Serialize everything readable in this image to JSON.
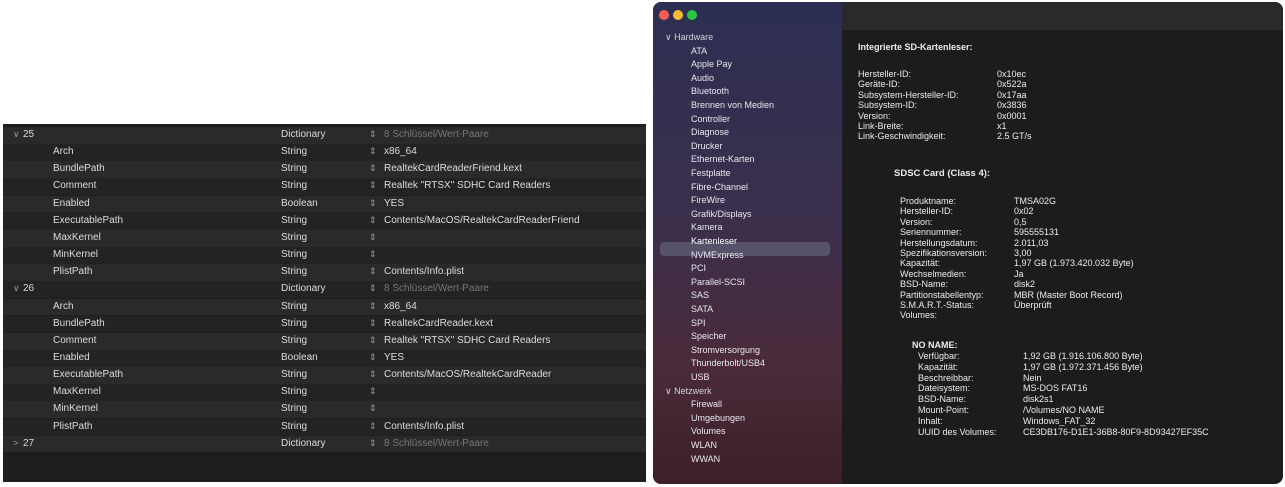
{
  "plist_editor": {
    "rows": [
      {
        "level": "group",
        "disclosure": "∨",
        "key": "25",
        "type": "Dictionary",
        "value": "8 Schlüssel/Wert-Paare",
        "dim": true
      },
      {
        "level": "child",
        "key": "Arch",
        "type": "String",
        "value": "x86_64"
      },
      {
        "level": "child",
        "key": "BundlePath",
        "type": "String",
        "value": "RealtekCardReaderFriend.kext"
      },
      {
        "level": "child",
        "key": "Comment",
        "type": "String",
        "value": "Realtek \"RTSX\" SDHC Card Readers"
      },
      {
        "level": "child",
        "key": "Enabled",
        "type": "Boolean",
        "value": "YES"
      },
      {
        "level": "child",
        "key": "ExecutablePath",
        "type": "String",
        "value": "Contents/MacOS/RealtekCardReaderFriend"
      },
      {
        "level": "child",
        "key": "MaxKernel",
        "type": "String",
        "value": ""
      },
      {
        "level": "child",
        "key": "MinKernel",
        "type": "String",
        "value": ""
      },
      {
        "level": "child",
        "key": "PlistPath",
        "type": "String",
        "value": "Contents/Info.plist"
      },
      {
        "level": "group",
        "disclosure": "∨",
        "key": "26",
        "type": "Dictionary",
        "value": "8 Schlüssel/Wert-Paare",
        "dim": true
      },
      {
        "level": "child",
        "key": "Arch",
        "type": "String",
        "value": "x86_64"
      },
      {
        "level": "child",
        "key": "BundlePath",
        "type": "String",
        "value": "RealtekCardReader.kext"
      },
      {
        "level": "child",
        "key": "Comment",
        "type": "String",
        "value": "Realtek \"RTSX\" SDHC Card Readers"
      },
      {
        "level": "child",
        "key": "Enabled",
        "type": "Boolean",
        "value": "YES"
      },
      {
        "level": "child",
        "key": "ExecutablePath",
        "type": "String",
        "value": "Contents/MacOS/RealtekCardReader"
      },
      {
        "level": "child",
        "key": "MaxKernel",
        "type": "String",
        "value": ""
      },
      {
        "level": "child",
        "key": "MinKernel",
        "type": "String",
        "value": ""
      },
      {
        "level": "child",
        "key": "PlistPath",
        "type": "String",
        "value": "Contents/Info.plist"
      },
      {
        "level": "group",
        "disclosure": ">",
        "key": "27",
        "type": "Dictionary",
        "value": "8 Schlüssel/Wert-Paare",
        "dim": true
      }
    ],
    "stepper_glyph": "⇕"
  },
  "system_info": {
    "traffic_lights": {
      "close": "#ff5f57",
      "minimize": "#febc2e",
      "zoom": "#28c840"
    },
    "sidebar": [
      {
        "kind": "group",
        "label": "Hardware",
        "disclosure": "∨"
      },
      {
        "kind": "child",
        "label": "ATA"
      },
      {
        "kind": "child",
        "label": "Apple Pay"
      },
      {
        "kind": "child",
        "label": "Audio"
      },
      {
        "kind": "child",
        "label": "Bluetooth"
      },
      {
        "kind": "child",
        "label": "Brennen von Medien"
      },
      {
        "kind": "child",
        "label": "Controller"
      },
      {
        "kind": "child",
        "label": "Diagnose"
      },
      {
        "kind": "child",
        "label": "Drucker"
      },
      {
        "kind": "child",
        "label": "Ethernet-Karten"
      },
      {
        "kind": "child",
        "label": "Festplatte"
      },
      {
        "kind": "child",
        "label": "Fibre-Channel"
      },
      {
        "kind": "child",
        "label": "FireWire"
      },
      {
        "kind": "child",
        "label": "Grafik/Displays"
      },
      {
        "kind": "child",
        "label": "Kamera"
      },
      {
        "kind": "child",
        "label": "Kartenleser",
        "selected": true
      },
      {
        "kind": "child",
        "label": "NVMExpress"
      },
      {
        "kind": "child",
        "label": "PCI"
      },
      {
        "kind": "child",
        "label": "Parallel-SCSI"
      },
      {
        "kind": "child",
        "label": "SAS"
      },
      {
        "kind": "child",
        "label": "SATA"
      },
      {
        "kind": "child",
        "label": "SPI"
      },
      {
        "kind": "child",
        "label": "Speicher"
      },
      {
        "kind": "child",
        "label": "Stromversorgung"
      },
      {
        "kind": "child",
        "label": "Thunderbolt/USB4"
      },
      {
        "kind": "child",
        "label": "USB"
      },
      {
        "kind": "group",
        "label": "Netzwerk",
        "disclosure": "∨"
      },
      {
        "kind": "child",
        "label": "Firewall"
      },
      {
        "kind": "child",
        "label": "Umgebungen"
      },
      {
        "kind": "child",
        "label": "Volumes"
      },
      {
        "kind": "child",
        "label": "WLAN"
      },
      {
        "kind": "child",
        "label": "WWAN"
      }
    ],
    "detail": {
      "heading": "Integrierte SD-Kartenleser:",
      "reader_props": [
        {
          "label": "Hersteller-ID:",
          "value": "0x10ec"
        },
        {
          "label": "Geräte-ID:",
          "value": "0x522a"
        },
        {
          "label": "Subsystem-Hersteller-ID:",
          "value": "0x17aa"
        },
        {
          "label": "Subsystem-ID:",
          "value": "0x3836"
        },
        {
          "label": "Version:",
          "value": "0x0001"
        },
        {
          "label": "Link-Breite:",
          "value": "x1"
        },
        {
          "label": "Link-Geschwindigkeit:",
          "value": "2.5 GT/s"
        }
      ],
      "card_heading": "SDSC Card (Class 4):",
      "card_props": [
        {
          "label": "Produktname:",
          "value": "TMSA02G"
        },
        {
          "label": "Hersteller-ID:",
          "value": "0x02"
        },
        {
          "label": "Version:",
          "value": "0,5"
        },
        {
          "label": "Seriennummer:",
          "value": "595555131"
        },
        {
          "label": "Herstellungsdatum:",
          "value": "2.011,03"
        },
        {
          "label": "Spezifikationsversion:",
          "value": "3,00"
        },
        {
          "label": "Kapazität:",
          "value": "1,97 GB (1.973.420.032 Byte)"
        },
        {
          "label": "Wechselmedien:",
          "value": "Ja"
        },
        {
          "label": "BSD-Name:",
          "value": "disk2"
        },
        {
          "label": "Partitionstabellentyp:",
          "value": "MBR (Master Boot Record)"
        },
        {
          "label": "S.M.A.R.T.-Status:",
          "value": "Überprüft"
        },
        {
          "label": "Volumes:",
          "value": ""
        }
      ],
      "volume_heading": "NO NAME:",
      "volume_props": [
        {
          "label": "Verfügbar:",
          "value": "1,92 GB (1.916.106.800 Byte)"
        },
        {
          "label": "Kapazität:",
          "value": "1,97 GB (1.972.371.456 Byte)"
        },
        {
          "label": "Beschreibbar:",
          "value": "Nein"
        },
        {
          "label": "Dateisystem:",
          "value": "MS-DOS FAT16"
        },
        {
          "label": "BSD-Name:",
          "value": "disk2s1"
        },
        {
          "label": "Mount-Point:",
          "value": "/Volumes/NO NAME"
        },
        {
          "label": "Inhalt:",
          "value": "Windows_FAT_32"
        },
        {
          "label": "UUID des Volumes:",
          "value": "CE3DB176-D1E1-36B8-80F9-8D93427EF35C"
        }
      ]
    }
  }
}
